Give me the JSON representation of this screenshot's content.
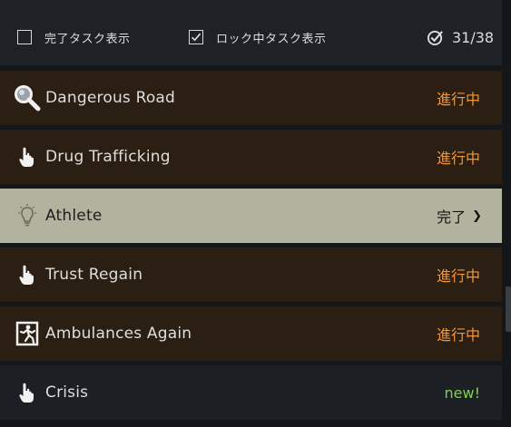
{
  "filters": {
    "completed_label": "完了タスク表示",
    "completed_checked": false,
    "locked_label": "ロック中タスク表示",
    "locked_checked": true
  },
  "counter": {
    "text": "31/38"
  },
  "tasks": [
    {
      "name": "Dangerous Road",
      "status": "進行中",
      "icon": "magnifier-icon",
      "state": "in-progress"
    },
    {
      "name": "Drug Trafficking",
      "status": "進行中",
      "icon": "pointing-hand-icon",
      "state": "in-progress"
    },
    {
      "name": "Athlete",
      "status": "完了",
      "icon": "lightbulb-icon",
      "state": "completed"
    },
    {
      "name": "Trust Regain",
      "status": "進行中",
      "icon": "pointing-hand-icon",
      "state": "in-progress"
    },
    {
      "name": "Ambulances Again",
      "status": "進行中",
      "icon": "emergency-exit-icon",
      "state": "in-progress"
    },
    {
      "name": "Crisis",
      "status": "new!",
      "icon": "pointing-hand-icon",
      "state": "new"
    }
  ],
  "colors": {
    "in_progress_status": "#f2963a",
    "new_status": "#7fd14a",
    "completed_row": "#b2b39e",
    "in_progress_row": "#2a1f12"
  }
}
